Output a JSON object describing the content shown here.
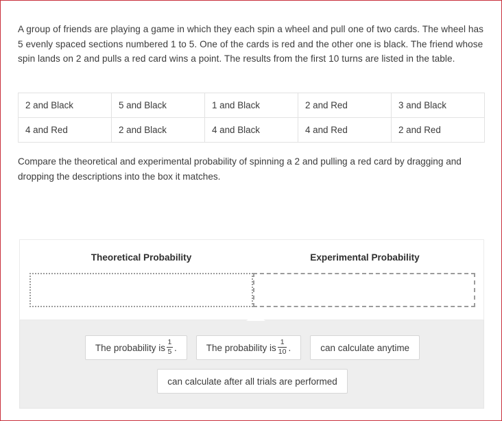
{
  "question": {
    "prompt": "A group of friends are playing a game in which they each spin a wheel and pull one of two cards. The wheel has 5 evenly spaced sections numbered 1 to 5. One of the cards is red and the other one is black. The friend whose spin lands on 2 and pulls a red card wins a point. The results from the first 10 turns are listed in the table.",
    "instruction": "Compare the theoretical and experimental probability of spinning a 2 and pulling a red card by dragging and dropping the descriptions into the box it matches."
  },
  "results_table": {
    "rows": [
      [
        "2 and Black",
        "5 and Black",
        "1 and Black",
        "2 and Red",
        "3 and Black"
      ],
      [
        "4 and Red",
        "2 and Black",
        "4 and Black",
        "4 and Red",
        "2 and Red"
      ]
    ]
  },
  "dropzones": [
    {
      "id": "theoretical",
      "label": "Theoretical Probability",
      "content": ""
    },
    {
      "id": "experimental",
      "label": "Experimental Probability",
      "content": ""
    }
  ],
  "chips": [
    {
      "id": "chip-prob-one-fifth",
      "prefix": "The probability is ",
      "numerator": "1",
      "denominator": "5",
      "suffix": "."
    },
    {
      "id": "chip-prob-one-tenth",
      "prefix": "The probability is ",
      "numerator": "1",
      "denominator": "10",
      "suffix": "."
    },
    {
      "id": "chip-anytime",
      "text": "can calculate anytime"
    },
    {
      "id": "chip-after-trials",
      "text": "can calculate after all trials are performed"
    }
  ],
  "colors": {
    "page_border": "#c9303c",
    "text": "#3b3b3b",
    "bank_background": "#eeeeee",
    "dropzone_border": "#9b9b9b",
    "table_border": "#e2e2e2",
    "chip_border": "#d6d6d6"
  }
}
